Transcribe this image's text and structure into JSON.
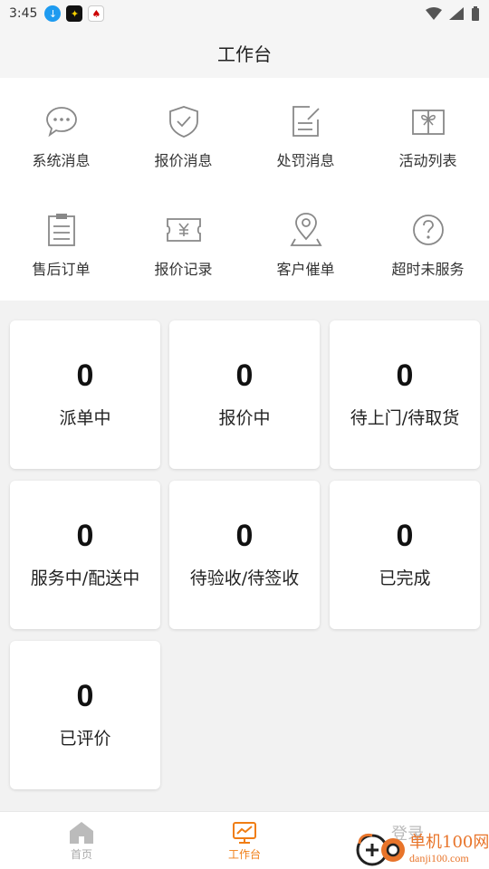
{
  "status_bar": {
    "time": "3:45"
  },
  "header": {
    "title": "工作台"
  },
  "menu": [
    {
      "label": "系统消息",
      "icon": "chat-bubble-icon"
    },
    {
      "label": "报价消息",
      "icon": "shield-check-icon"
    },
    {
      "label": "处罚消息",
      "icon": "document-edit-icon"
    },
    {
      "label": "活动列表",
      "icon": "gift-box-icon"
    },
    {
      "label": "售后订单",
      "icon": "clipboard-icon"
    },
    {
      "label": "报价记录",
      "icon": "ticket-yen-icon"
    },
    {
      "label": "客户催单",
      "icon": "location-pin-icon"
    },
    {
      "label": "超时未服务",
      "icon": "question-circle-icon"
    }
  ],
  "cards": [
    {
      "count": "0",
      "label": "派单中"
    },
    {
      "count": "0",
      "label": "报价中"
    },
    {
      "count": "0",
      "label": "待上门/待取货"
    },
    {
      "count": "0",
      "label": "服务中/配送中"
    },
    {
      "count": "0",
      "label": "待验收/待签收"
    },
    {
      "count": "0",
      "label": "已完成"
    },
    {
      "count": "0",
      "label": "已评价"
    }
  ],
  "tabbar": {
    "home_label": "首页",
    "workbench_label": "工作台",
    "profile_label": "登录"
  },
  "watermark": {
    "brand": "单机100网",
    "url": "danji100.com"
  },
  "colors": {
    "accent": "#f07d14",
    "icon_gray": "#888888",
    "background": "#f2f2f2"
  }
}
